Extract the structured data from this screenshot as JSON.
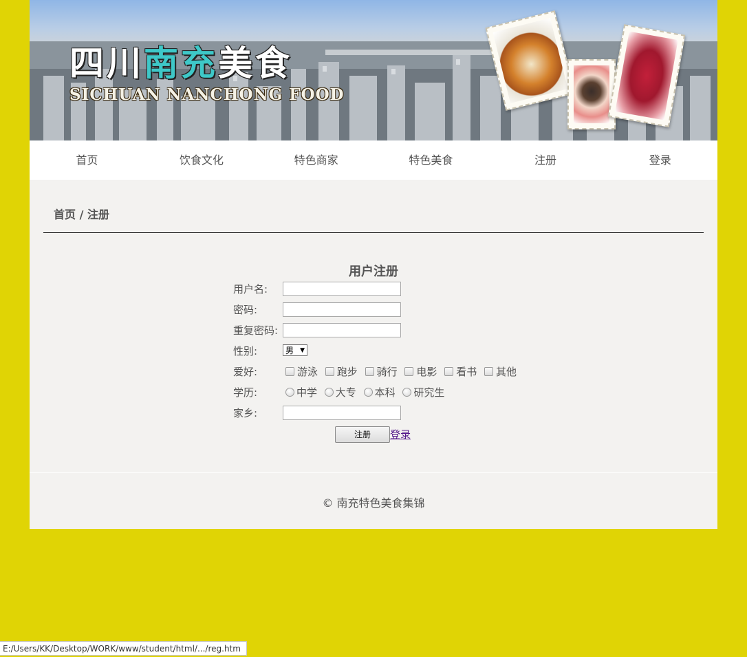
{
  "banner": {
    "logo_prefix": "四川",
    "logo_highlight": "南充",
    "logo_suffix": "美食",
    "logo_en": "SICHUAN NANCHONG FOOD"
  },
  "nav": [
    "首页",
    "饮食文化",
    "特色商家",
    "特色美食",
    "注册",
    "登录"
  ],
  "breadcrumb": "首页 / 注册",
  "form": {
    "title": "用户注册",
    "username_label": "用户名:",
    "password_label": "密码:",
    "repeat_label": "重复密码:",
    "gender_label": "性别:",
    "gender_value": "男",
    "hobby_label": "爱好:",
    "hobbies": [
      "游泳",
      "跑步",
      "骑行",
      "电影",
      "看书",
      "其他"
    ],
    "education_label": "学历:",
    "education": [
      "中学",
      "大专",
      "本科",
      "研究生"
    ],
    "hometown_label": "家乡:",
    "submit_label": "注册",
    "login_link": "登录"
  },
  "footer": "© 南充特色美食集锦",
  "status_bar": "E:/Users/KK/Desktop/WORK/www/student/html/.../reg.htm",
  "colors": {
    "page_bg": "#e0d405",
    "content_bg": "#f3f2f0",
    "logo_accent": "#3ec8c8",
    "visited_link": "#551a8b"
  }
}
